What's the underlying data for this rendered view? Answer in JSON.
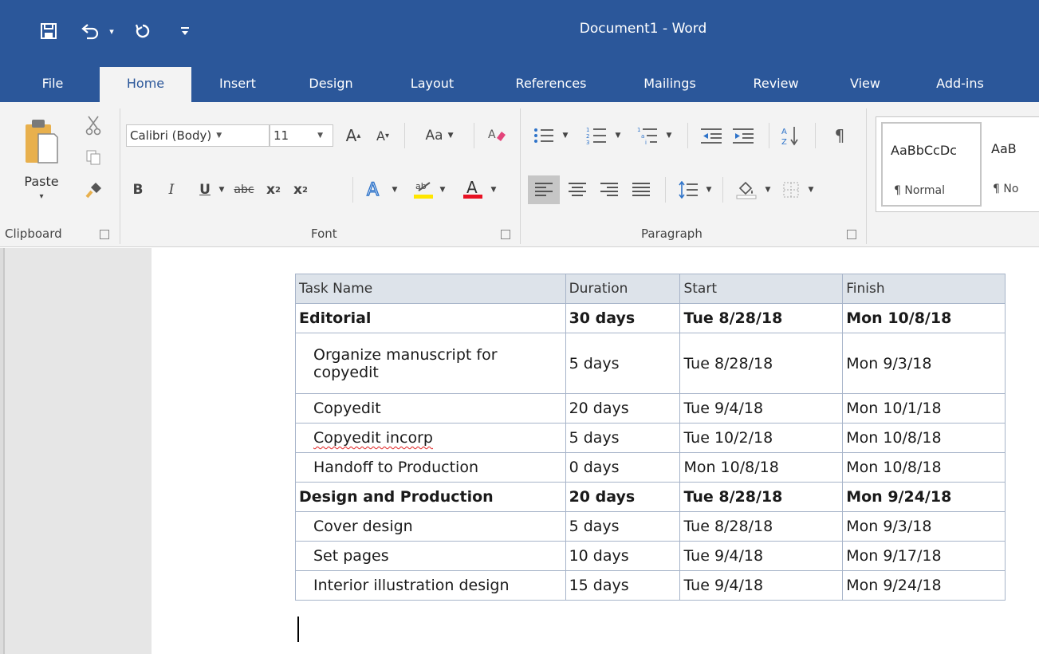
{
  "window": {
    "title": "Document1 - Word",
    "accent": "#2b579a"
  },
  "quick_access": {
    "icons": [
      "save-icon",
      "undo-icon",
      "redo-icon",
      "customize-icon"
    ]
  },
  "tabs": [
    {
      "label": "File"
    },
    {
      "label": "Home",
      "active": true
    },
    {
      "label": "Insert"
    },
    {
      "label": "Design"
    },
    {
      "label": "Layout"
    },
    {
      "label": "References"
    },
    {
      "label": "Mailings"
    },
    {
      "label": "Review"
    },
    {
      "label": "View"
    },
    {
      "label": "Add-ins"
    }
  ],
  "ribbon": {
    "clipboard": {
      "paste_label": "Paste",
      "group_label": "Clipboard"
    },
    "font": {
      "font_name": "Calibri (Body)",
      "font_size": "11",
      "change_case_label": "Aa",
      "group_label": "Font"
    },
    "paragraph": {
      "group_label": "Paragraph"
    },
    "styles": [
      {
        "sample": "AaBbCcDc",
        "name": "¶ Normal"
      },
      {
        "sample": "AaB",
        "name": "¶ No"
      }
    ]
  },
  "table": {
    "headers": [
      "Task Name",
      "Duration",
      "Start",
      "Finish"
    ],
    "rows": [
      {
        "name": "Editorial",
        "duration": "30 days",
        "start": "Tue 8/28/18",
        "finish": "Mon 10/8/18",
        "summary": true
      },
      {
        "name": "Organize manuscript for copyedit",
        "duration": "5 days",
        "start": "Tue 8/28/18",
        "finish": "Mon 9/3/18",
        "summary": false
      },
      {
        "name": "Copyedit",
        "duration": "20 days",
        "start": "Tue 9/4/18",
        "finish": "Mon 10/1/18",
        "summary": false
      },
      {
        "name": "Copyedit incorp",
        "duration": "5 days",
        "start": "Tue 10/2/18",
        "finish": "Mon 10/8/18",
        "summary": false
      },
      {
        "name": "Handoff to Production",
        "duration": "0 days",
        "start": "Mon 10/8/18",
        "finish": "Mon 10/8/18",
        "summary": false
      },
      {
        "name": "Design and Production",
        "duration": "20 days",
        "start": "Tue 8/28/18",
        "finish": "Mon 9/24/18",
        "summary": true
      },
      {
        "name": "Cover design",
        "duration": "5 days",
        "start": "Tue 8/28/18",
        "finish": "Mon 9/3/18",
        "summary": false
      },
      {
        "name": "Set pages",
        "duration": "10 days",
        "start": "Tue 9/4/18",
        "finish": "Mon 9/17/18",
        "summary": false
      },
      {
        "name": "Interior illustration design",
        "duration": "15 days",
        "start": "Tue 9/4/18",
        "finish": "Mon 9/24/18",
        "summary": false
      }
    ]
  }
}
